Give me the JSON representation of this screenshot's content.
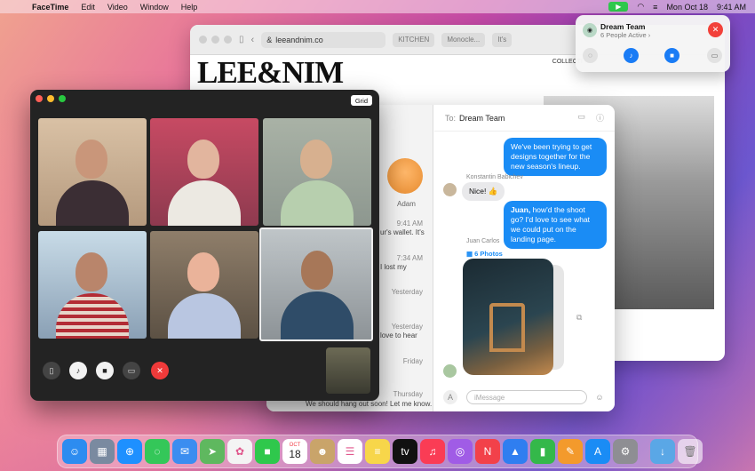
{
  "menubar": {
    "app": "FaceTime",
    "items": [
      "Edit",
      "Video",
      "Window",
      "Help"
    ],
    "date": "Mon Oct 18",
    "time": "9:41 AM"
  },
  "browser": {
    "url": "leeandnim.co",
    "tabs": [
      "KITCHEN",
      "Monocle...",
      "It's"
    ],
    "site_logo": "LEE&NIM",
    "site_nav": "COLLECTI"
  },
  "shareplay": {
    "title": "Dream Team",
    "subtitle": "6 People Active ›"
  },
  "facetime": {
    "grid_label": "Grid"
  },
  "messages": {
    "to_label": "To:",
    "to_name": "Dream Team",
    "contact_name": "Adam",
    "list_rows": [
      {
        "time": "9:41 AM",
        "snippet": "ur's wallet. It's"
      },
      {
        "time": "7:34 AM",
        "snippet": "I lost my"
      },
      {
        "time": "Yesterday",
        "snippet": ""
      },
      {
        "time": "Yesterday",
        "snippet": "love to hear"
      },
      {
        "time": "Friday",
        "snippet": ""
      },
      {
        "time": "Thursday",
        "snippet": "We should hang out soon! Let me know."
      }
    ],
    "thread": {
      "msg1": "We've been trying to get designs together for the new season's lineup.",
      "sender2": "Konstantin Babichev",
      "msg2": "Nice! 👍",
      "msg3_bold": "Juan,",
      "msg3": " how'd the shoot go? I'd love to see what we could put on the landing page.",
      "sender4": "Juan Carlos",
      "photos_label": "6 Photos"
    },
    "compose_placeholder": "iMessage"
  },
  "dock": {
    "apps": [
      {
        "name": "finder-icon",
        "color": "#2d8cf0"
      },
      {
        "name": "launchpad-icon",
        "color": "#7a8aa0"
      },
      {
        "name": "safari-icon",
        "color": "#1e90ff"
      },
      {
        "name": "messages-icon",
        "color": "#34c759"
      },
      {
        "name": "mail-icon",
        "color": "#3b8df0"
      },
      {
        "name": "maps-icon",
        "color": "#5fb85f"
      },
      {
        "name": "photos-icon",
        "color": "#f4f4f4"
      },
      {
        "name": "facetime-icon",
        "color": "#2fc84c"
      },
      {
        "name": "calendar-icon",
        "color": "#ffffff"
      },
      {
        "name": "contacts-icon",
        "color": "#c9a46a"
      },
      {
        "name": "reminders-icon",
        "color": "#ffffff"
      },
      {
        "name": "notes-icon",
        "color": "#f7d64a"
      },
      {
        "name": "tv-icon",
        "color": "#111111"
      },
      {
        "name": "music-icon",
        "color": "#fa3c55"
      },
      {
        "name": "podcasts-icon",
        "color": "#a05ce6"
      },
      {
        "name": "news-icon",
        "color": "#f2414a"
      },
      {
        "name": "keynote-icon",
        "color": "#2f7ef0"
      },
      {
        "name": "numbers-icon",
        "color": "#34b84a"
      },
      {
        "name": "pages-icon",
        "color": "#f39a2c"
      },
      {
        "name": "app-store-icon",
        "color": "#1a8cf5"
      },
      {
        "name": "system-preferences-icon",
        "color": "#8e8e93"
      }
    ],
    "calendar": {
      "month": "OCT",
      "day": "18"
    }
  }
}
